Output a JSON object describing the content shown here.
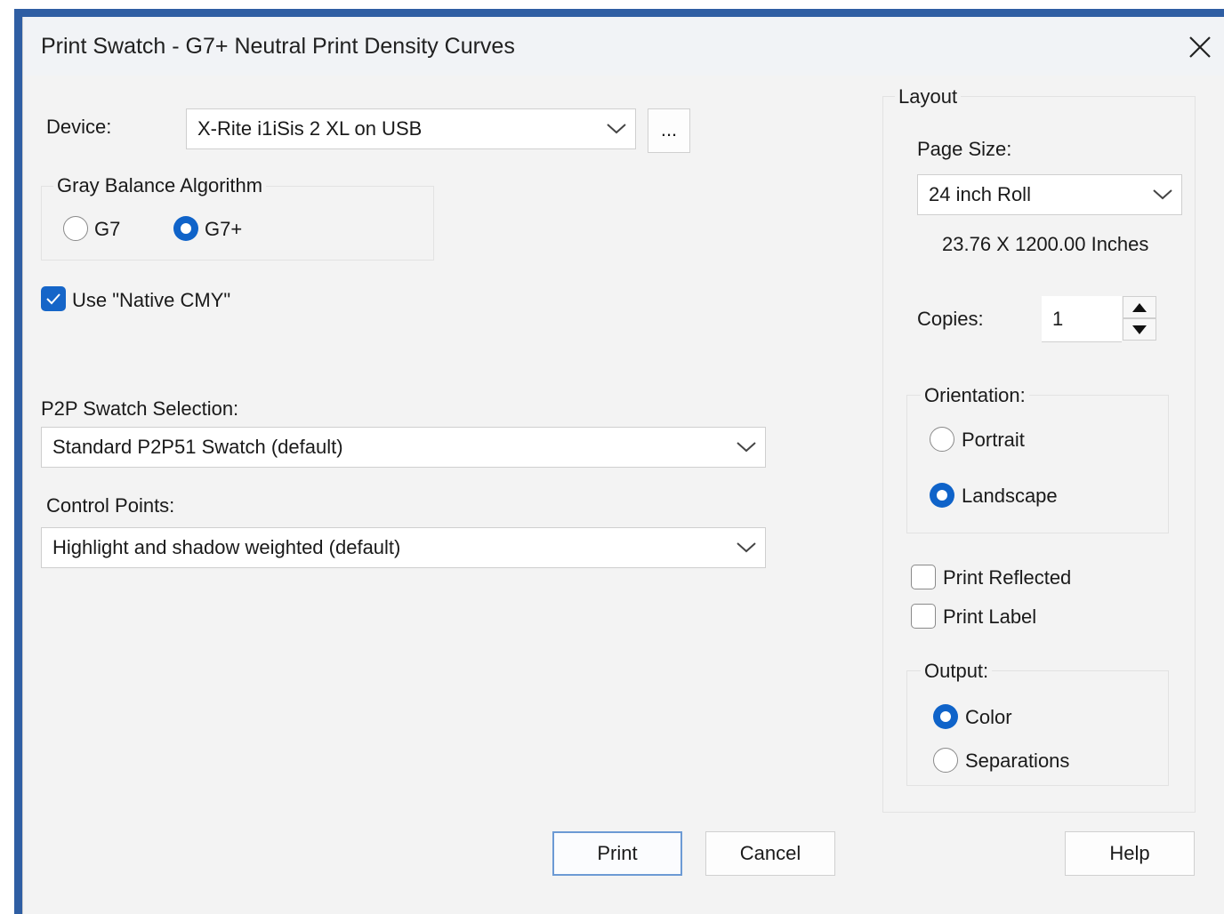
{
  "dialog": {
    "title": "Print Swatch - G7+ Neutral Print Density Curves"
  },
  "device": {
    "label": "Device:",
    "value": "X-Rite i1iSis 2 XL on USB",
    "browse_label": "..."
  },
  "gray_balance": {
    "title": "Gray Balance Algorithm",
    "options": [
      {
        "label": "G7",
        "selected": false
      },
      {
        "label": "G7+",
        "selected": true
      }
    ]
  },
  "native_cmy": {
    "label": "Use \"Native CMY\"",
    "checked": true
  },
  "swatch_selection": {
    "label": "P2P Swatch Selection:",
    "value": "Standard P2P51 Swatch (default)"
  },
  "control_points": {
    "label": "Control Points:",
    "value": "Highlight and shadow weighted (default)"
  },
  "layout": {
    "title": "Layout",
    "page_size_label": "Page Size:",
    "page_size_value": "24 inch Roll",
    "dimensions": "23.76 X 1200.00 Inches",
    "copies_label": "Copies:",
    "copies_value": "1",
    "orientation": {
      "title": "Orientation:",
      "options": [
        {
          "label": "Portrait",
          "selected": false
        },
        {
          "label": "Landscape",
          "selected": true
        }
      ]
    },
    "print_reflected": {
      "label": "Print Reflected",
      "checked": false
    },
    "print_label": {
      "label": "Print Label",
      "checked": false
    },
    "output": {
      "title": "Output:",
      "options": [
        {
          "label": "Color",
          "selected": true
        },
        {
          "label": "Separations",
          "selected": false
        }
      ]
    }
  },
  "buttons": {
    "print": "Print",
    "cancel": "Cancel",
    "help": "Help"
  },
  "colors": {
    "accent": "#0f63c9",
    "frame": "#2f5ea3",
    "dialog_bg": "#f3f3f3"
  },
  "icons": {
    "close": "close-icon",
    "dropdown": "chevron-down-icon",
    "spin_up": "arrow-up-icon",
    "spin_down": "arrow-down-icon",
    "check": "checkmark-icon"
  }
}
